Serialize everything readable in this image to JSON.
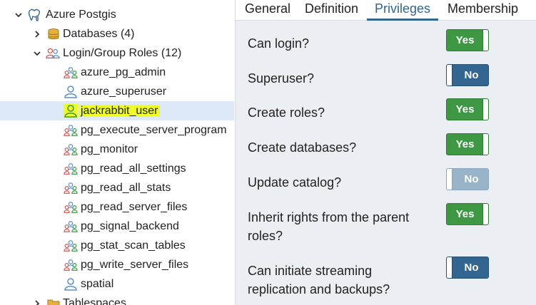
{
  "tree": {
    "top_partial": "",
    "server": {
      "label": "Azure Postgis"
    },
    "databases": {
      "label": "Databases (4)"
    },
    "login_roles": {
      "label": "Login/Group Roles (12)"
    },
    "roles": [
      {
        "label": "azure_pg_admin",
        "kind": "group",
        "selected": false
      },
      {
        "label": "azure_superuser",
        "kind": "user",
        "selected": false
      },
      {
        "label": "jackrabbit_user",
        "kind": "user",
        "selected": true
      },
      {
        "label": "pg_execute_server_program",
        "kind": "group",
        "selected": false
      },
      {
        "label": "pg_monitor",
        "kind": "group",
        "selected": false
      },
      {
        "label": "pg_read_all_settings",
        "kind": "group",
        "selected": false
      },
      {
        "label": "pg_read_all_stats",
        "kind": "group",
        "selected": false
      },
      {
        "label": "pg_read_server_files",
        "kind": "group",
        "selected": false
      },
      {
        "label": "pg_signal_backend",
        "kind": "group",
        "selected": false
      },
      {
        "label": "pg_stat_scan_tables",
        "kind": "group",
        "selected": false
      },
      {
        "label": "pg_write_server_files",
        "kind": "group",
        "selected": false
      },
      {
        "label": "spatial",
        "kind": "user",
        "selected": false
      }
    ],
    "tablespaces": {
      "label": "Tablespaces"
    }
  },
  "tabs": [
    {
      "label": "General",
      "active": false
    },
    {
      "label": "Definition",
      "active": false
    },
    {
      "label": "Privileges",
      "active": true
    },
    {
      "label": "Membership",
      "active": false
    },
    {
      "label": "",
      "active": false
    }
  ],
  "privileges": [
    {
      "label": "Can login?",
      "value": "Yes",
      "state": "on",
      "disabled": false
    },
    {
      "label": "Superuser?",
      "value": "No",
      "state": "off",
      "disabled": false
    },
    {
      "label": "Create roles?",
      "value": "Yes",
      "state": "on",
      "disabled": false
    },
    {
      "label": "Create databases?",
      "value": "Yes",
      "state": "on",
      "disabled": false
    },
    {
      "label": "Update catalog?",
      "value": "No",
      "state": "off",
      "disabled": true
    },
    {
      "label": "Inherit rights from the parent roles?",
      "value": "Yes",
      "state": "on",
      "disabled": false
    },
    {
      "label": "Can initiate streaming replication and backups?",
      "value": "No",
      "state": "off",
      "disabled": false
    }
  ],
  "colors": {
    "accent": "#326690",
    "toggle_on": "#3d9743",
    "toggle_off": "#326690",
    "selection": "#dde9f6",
    "highlight": "#eefc2a"
  }
}
